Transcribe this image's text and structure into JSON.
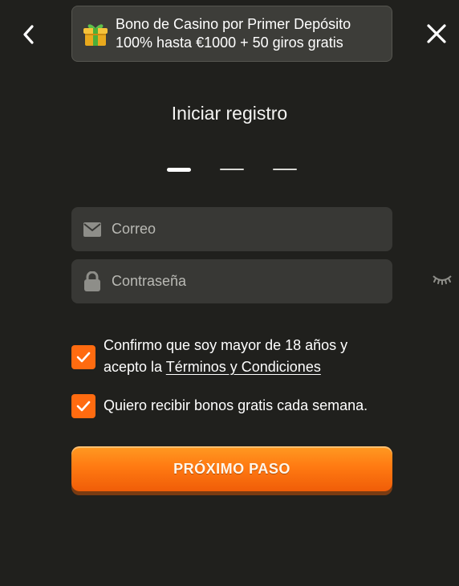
{
  "promo": {
    "line1": "Bono de Casino por Primer Depósito",
    "line2": "100% hasta €1000 + 50 giros gratis",
    "icon": "gift-icon"
  },
  "title": "Iniciar registro",
  "steps": {
    "total": 3,
    "current": 1
  },
  "email": {
    "placeholder": "Correo",
    "value": "",
    "icon": "envelope-icon"
  },
  "password": {
    "placeholder": "Contraseña",
    "value": "",
    "icon": "lock-icon",
    "toggle_icon": "eye-closed-icon"
  },
  "consent": {
    "age_text": "Confirmo que soy mayor de 18 años y acepto la",
    "age_link": "Términos y Condiciones",
    "age_checked": true,
    "bonus_text": "Quiero recibir bonos gratis cada semana.",
    "bonus_checked": true
  },
  "next_button": "PRÓXIMO PASO",
  "colors": {
    "background": "#20201d",
    "field": "#383835",
    "accent": "#ff6b10"
  }
}
